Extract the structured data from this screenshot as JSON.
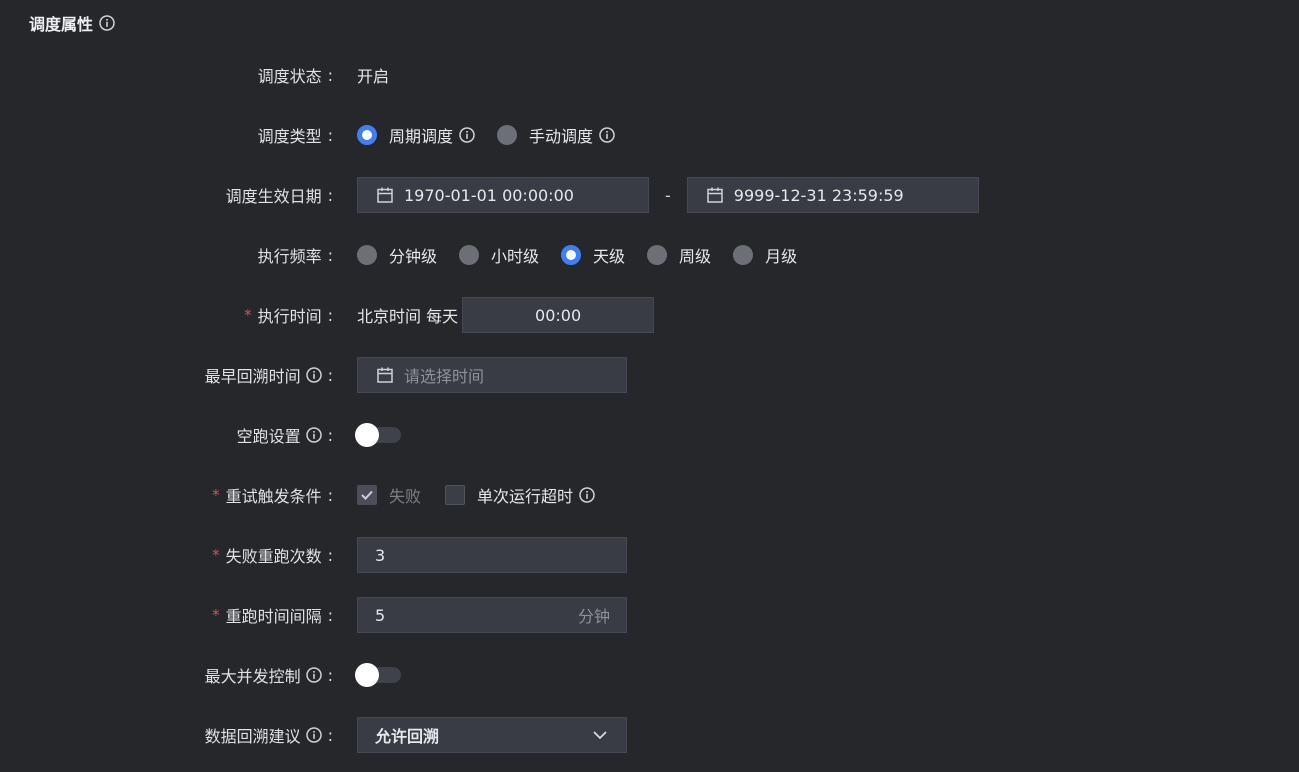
{
  "section": {
    "title": "调度属性",
    "info_icon": "info-icon"
  },
  "colon": ":",
  "schedule_status": {
    "label": "调度状态",
    "value": "开启"
  },
  "schedule_type": {
    "label": "调度类型",
    "options": [
      {
        "label": "周期调度",
        "selected": true
      },
      {
        "label": "手动调度",
        "selected": false
      }
    ]
  },
  "effective_date": {
    "label": "调度生效日期",
    "start": "1970-01-01 00:00:00",
    "separator": "-",
    "end": "9999-12-31 23:59:59"
  },
  "frequency": {
    "label": "执行频率",
    "options": [
      {
        "label": "分钟级",
        "selected": false
      },
      {
        "label": "小时级",
        "selected": false
      },
      {
        "label": "天级",
        "selected": true
      },
      {
        "label": "周级",
        "selected": false
      },
      {
        "label": "月级",
        "selected": false
      }
    ]
  },
  "exec_time": {
    "required": "*",
    "label": "执行时间",
    "prefix": "北京时间 每天",
    "value": "00:00"
  },
  "earliest_backfill": {
    "label": "最早回溯时间",
    "placeholder": "请选择时间"
  },
  "dry_run": {
    "label": "空跑设置",
    "enabled": false
  },
  "retry_condition": {
    "required": "*",
    "label": "重试触发条件",
    "options": [
      {
        "label": "失败",
        "checked": true,
        "disabled": true
      },
      {
        "label": "单次运行超时",
        "checked": false
      }
    ]
  },
  "retry_count": {
    "required": "*",
    "label": "失败重跑次数",
    "value": "3"
  },
  "retry_interval": {
    "required": "*",
    "label": "重跑时间间隔",
    "value": "5",
    "unit": "分钟"
  },
  "max_concurrency": {
    "label": "最大并发控制",
    "enabled": false
  },
  "backfill_suggestion": {
    "label": "数据回溯建议",
    "value": "允许回溯"
  },
  "colors": {
    "accent": "#3f7ef5",
    "required": "#d9534f",
    "background": "#26272b",
    "input_bg": "#393c45"
  }
}
